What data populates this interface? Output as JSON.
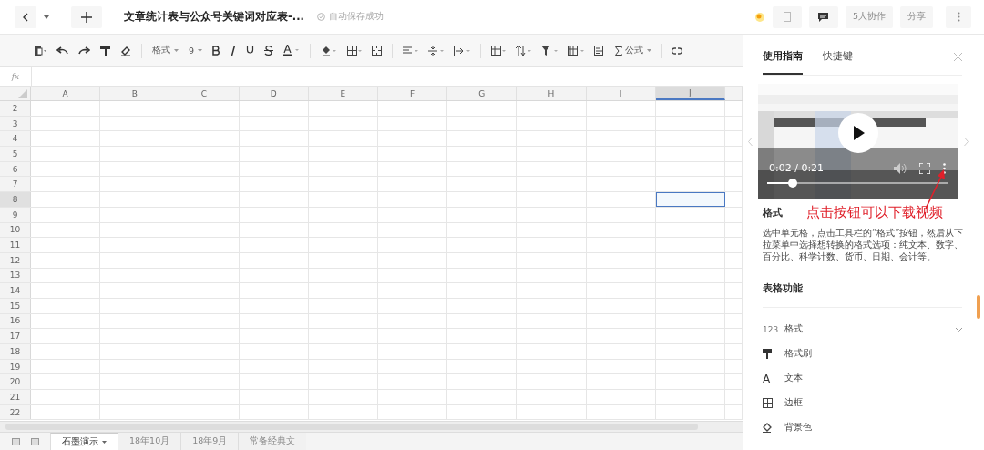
{
  "top_bar": {
    "title": "文章统计表与公众号关键词对应表-...",
    "save_status": "自动保存成功",
    "collaborators": "5人协作",
    "share": "分享"
  },
  "toolbar": {
    "format": "格式",
    "font_size": "9",
    "formula": "公式"
  },
  "formula_bar": {
    "label": "fx"
  },
  "sheet": {
    "columns": [
      {
        "label": "A",
        "selected": false
      },
      {
        "label": "B",
        "selected": false
      },
      {
        "label": "C",
        "selected": false
      },
      {
        "label": "D",
        "selected": false
      },
      {
        "label": "E",
        "selected": false
      },
      {
        "label": "F",
        "selected": false
      },
      {
        "label": "G",
        "selected": false
      },
      {
        "label": "H",
        "selected": false
      },
      {
        "label": "I",
        "selected": false
      },
      {
        "label": "J",
        "selected": true
      }
    ],
    "rows": [
      {
        "label": "2",
        "selected": false
      },
      {
        "label": "3",
        "selected": false
      },
      {
        "label": "4",
        "selected": false
      },
      {
        "label": "5",
        "selected": false
      },
      {
        "label": "6",
        "selected": false
      },
      {
        "label": "7",
        "selected": false
      },
      {
        "label": "8",
        "selected": true
      },
      {
        "label": "9",
        "selected": false
      },
      {
        "label": "10",
        "selected": false
      },
      {
        "label": "11",
        "selected": false
      },
      {
        "label": "12",
        "selected": false
      },
      {
        "label": "13",
        "selected": false
      },
      {
        "label": "14",
        "selected": false
      },
      {
        "label": "15",
        "selected": false
      },
      {
        "label": "16",
        "selected": false
      },
      {
        "label": "17",
        "selected": false
      },
      {
        "label": "18",
        "selected": false
      },
      {
        "label": "19",
        "selected": false
      },
      {
        "label": "20",
        "selected": false
      },
      {
        "label": "21",
        "selected": false
      },
      {
        "label": "22",
        "selected": false
      }
    ]
  },
  "sheet_tabs": [
    {
      "label": "石墨演示",
      "selected": true
    },
    {
      "label": "18年10月",
      "selected": false
    },
    {
      "label": "18年9月",
      "selected": false
    },
    {
      "label": "常备经典文",
      "selected": false
    }
  ],
  "panel": {
    "tabs": [
      {
        "label": "使用指南",
        "selected": true
      },
      {
        "label": "快捷键",
        "selected": false
      }
    ],
    "video": {
      "kind": "picture",
      "time": "0:02 / 0:21",
      "level": 0.14
    },
    "annotation": "点击按钮可以下载视频",
    "section_title": "格式",
    "description": "选中单元格，点击工具栏的“格式”按钮，然后从下拉菜单中选择想转换的格式选项：纯文本、数字、百分比、科学计数、货币、日期、会计等。",
    "features_title": "表格功能",
    "features": [
      {
        "kind": "number",
        "glyph": "123",
        "label": "格式",
        "expanded": false
      },
      {
        "kind": "brush",
        "label": "格式刷"
      },
      {
        "kind": "text",
        "glyph": "A",
        "label": "文本"
      },
      {
        "kind": "border",
        "label": "边框"
      },
      {
        "kind": "fill",
        "label": "背景色"
      }
    ]
  }
}
